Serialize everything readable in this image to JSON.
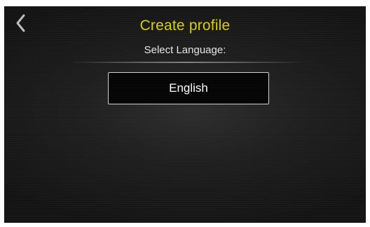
{
  "header": {
    "title": "Create profile",
    "subtitle": "Select Language:",
    "back_icon": "chevron-left-icon"
  },
  "language": {
    "selected_label": "English"
  },
  "colors": {
    "title": "#d9d000",
    "text": "#e6e6e6",
    "background": "#1f1f1f",
    "button_border": "#cfcfcf"
  }
}
